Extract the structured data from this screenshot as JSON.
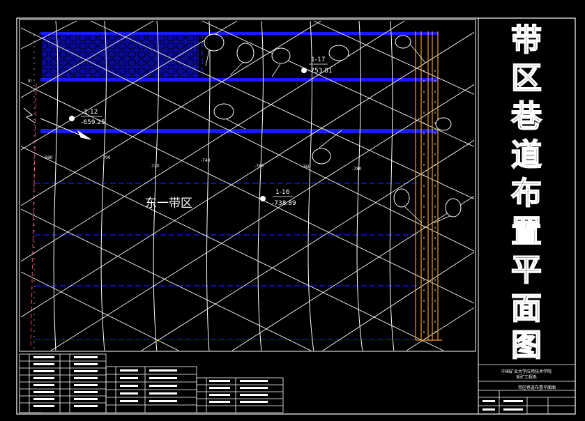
{
  "drawing": {
    "vertical_title": [
      "带",
      "区",
      "巷",
      "道",
      "布",
      "置",
      "平",
      "面",
      "图"
    ],
    "zone_label": "东一带区",
    "boreholes": [
      {
        "id": "1-12",
        "elev": "-659.25"
      },
      {
        "id": "1-17",
        "elev": "-753.81"
      },
      {
        "id": "1-16",
        "elev": "-738.89"
      }
    ],
    "contour_labels": [
      "-680",
      "-700",
      "-720",
      "-740",
      "-760",
      "-780"
    ],
    "north_label": "N",
    "left_mark": "III"
  },
  "title_block": {
    "org_line1": "中国矿业大学应用技术学院",
    "org_line2": "采矿工程系",
    "drawing_name": "带区巷道布置平面图"
  },
  "colors": {
    "background": "#000000",
    "lines": "#ffffff",
    "roadway": "#1a1aff",
    "shaft_lines": "#f0a020"
  },
  "icons": [
    "north-arrow-icon",
    "borehole-icon",
    "equipment-symbol-icon"
  ]
}
